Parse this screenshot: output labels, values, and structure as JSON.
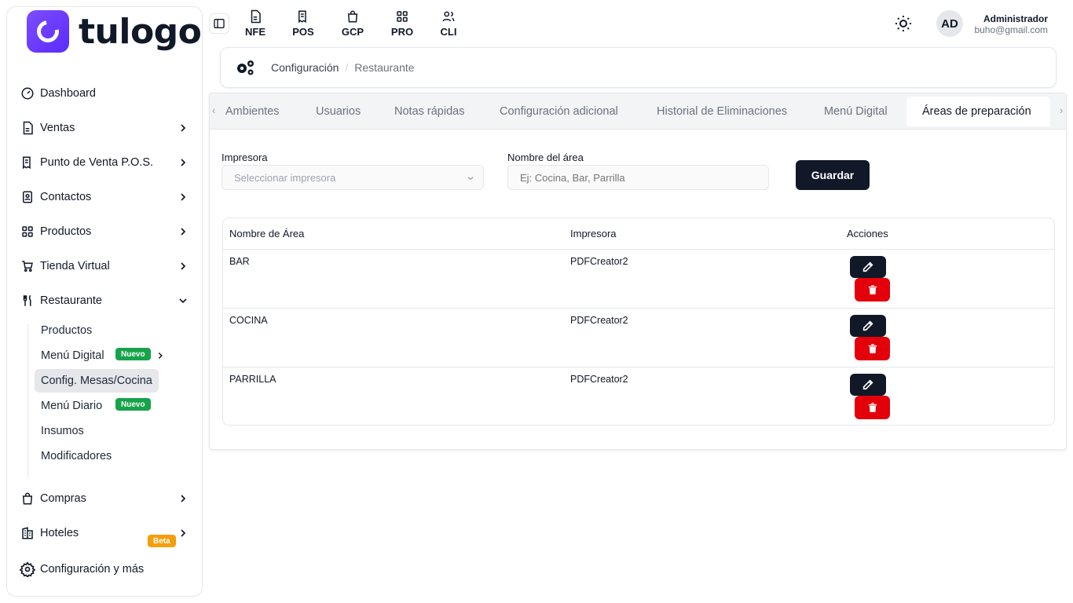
{
  "brand": {
    "name": "tulogo",
    "color": "#6a3cff"
  },
  "sidebar": {
    "items": [
      {
        "label": "Dashboard",
        "icon": "dashboard-icon"
      },
      {
        "label": "Ventas",
        "icon": "document-icon"
      },
      {
        "label": "Punto de Venta P.O.S.",
        "icon": "pos-receipt-icon"
      },
      {
        "label": "Contactos",
        "icon": "contacts-icon"
      },
      {
        "label": "Productos",
        "icon": "grid-icon"
      },
      {
        "label": "Tienda Virtual",
        "icon": "cart-icon"
      },
      {
        "label": "Restaurante",
        "icon": "fork-knife-icon"
      }
    ],
    "restaurant_sub": [
      {
        "label": "Productos"
      },
      {
        "label": "Menú Digital",
        "badge": "Nuevo"
      },
      {
        "label": "Config. Mesas/Cocina"
      },
      {
        "label": "Menú Diario",
        "badge": "Nuevo"
      },
      {
        "label": "Insumos"
      },
      {
        "label": "Modificadores"
      }
    ],
    "bottom": [
      {
        "label": "Compras",
        "icon": "bag-icon"
      },
      {
        "label": "Hoteles",
        "icon": "hotel-icon",
        "badge": "Beta"
      }
    ],
    "settings": "Configuración y más"
  },
  "topbar": {
    "quick": [
      "NFE",
      "POS",
      "GCP",
      "PRO",
      "CLI"
    ],
    "user": {
      "initials": "AD",
      "name": "Administrador",
      "email": "buho@gmail.com"
    }
  },
  "breadcrumb": {
    "first": "Configuración",
    "separator": "/",
    "second": "Restaurante"
  },
  "tabs": [
    "Ambientes",
    "Usuarios",
    "Notas rápidas",
    "Configuración adicional",
    "Historial de Eliminaciones",
    "Menú Digital",
    "Áreas de preparación"
  ],
  "form": {
    "printer_label": "Impresora",
    "printer_placeholder": "Seleccionar impresora",
    "area_label": "Nombre del área",
    "area_placeholder": "Ej: Cocina, Bar, Parrilla",
    "save": "Guardar"
  },
  "table": {
    "headers": [
      "Nombre de Área",
      "Impresora",
      "Acciones"
    ],
    "rows": [
      {
        "area": "BAR",
        "printer": "PDFCreator2"
      },
      {
        "area": "COCINA",
        "printer": "PDFCreator2"
      },
      {
        "area": "PARRILLA",
        "printer": "PDFCreator2"
      }
    ]
  }
}
